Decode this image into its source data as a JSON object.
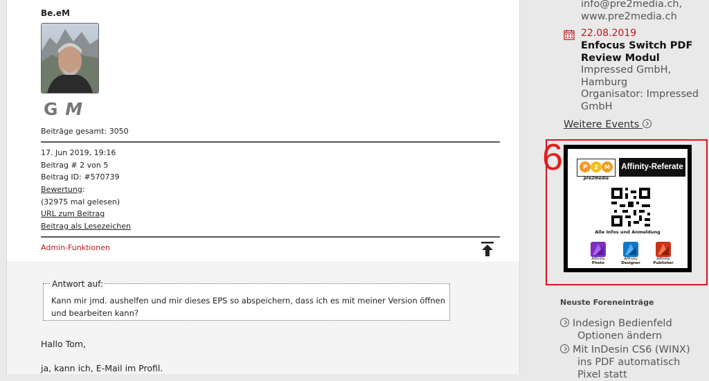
{
  "post": {
    "author": "Be.eM",
    "signature_initial_1": "G",
    "signature_initial_2": "M",
    "total_posts": "Beiträge gesamt: 3050",
    "date": "17. Jun 2019, 19:16",
    "post_number": "Beitrag # 2 von 5",
    "post_id": "Beitrag ID: #570739",
    "rating_label": "Bewertung",
    "rating_suffix": ":",
    "read_count": "(32975 mal gelesen)",
    "url_link": "URL zum Beitrag",
    "bookmark_link": "Beitrag als Lesezeichen",
    "admin_label": "Admin-Funktionen"
  },
  "quote": {
    "legend": "Antwort auf:",
    "text": "Kann mir jmd. aushelfen und mir dieses EPS so abspeichern, dass ich es mit meiner Version öffnen und bearbeiten kann?"
  },
  "reply": {
    "greeting": "Hallo Tom,",
    "line1": "ja, kann ich, E-Mail im Profil."
  },
  "sidebar": {
    "contact_line1": "info@pre2media.ch,",
    "contact_line2": "www.pre2media.ch",
    "event": {
      "date": "22.08.2019",
      "title": "Enfocus Switch PDF Review Modul",
      "location_line1": "Impressed GmbH,",
      "location_line2": "Hamburg",
      "organizer_line1": "Organisator: Impressed",
      "organizer_line2": "GmbH"
    },
    "more_events": "Weitere Events",
    "ad": {
      "number": "6",
      "brand": "pre2media",
      "heading": "Affinity-Referate",
      "caption": "Alle Infos und Anmeldung",
      "apps": [
        {
          "name": "Affinity",
          "sub": "Photo",
          "color": "#9a3fd0"
        },
        {
          "name": "Affinity",
          "sub": "Designer",
          "color": "#1e8fd8"
        },
        {
          "name": "Affinity",
          "sub": "Publisher",
          "color": "#d6411f"
        }
      ]
    },
    "forum_heading": "Neuste Foreneinträge",
    "forum_items": [
      {
        "line1": "Indesign Bedienfeld",
        "line2": "Optionen ändern"
      },
      {
        "line1": "Mit InDesin CS6 (WINX)",
        "line2": "ins PDF automatisch",
        "line3": "Pixel  statt"
      }
    ]
  },
  "colors": {
    "accent_red": "#c0161b",
    "ad_border": "#d4161b"
  }
}
